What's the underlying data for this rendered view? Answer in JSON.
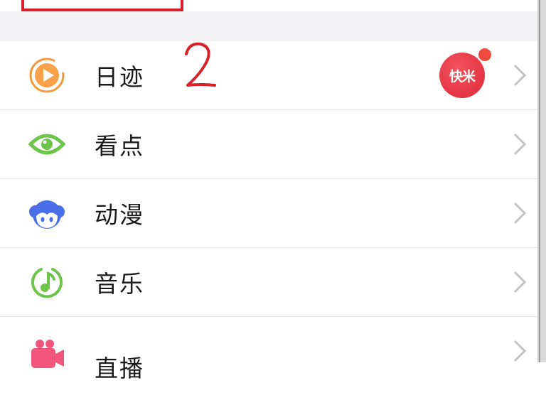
{
  "menu": {
    "items": [
      {
        "label": "日迹",
        "icon": "orange-play-circle-icon",
        "badge": "快米"
      },
      {
        "label": "看点",
        "icon": "green-eye-icon"
      },
      {
        "label": "动漫",
        "icon": "blue-anime-face-icon"
      },
      {
        "label": "音乐",
        "icon": "green-music-note-icon"
      },
      {
        "label": "直播",
        "icon": "pink-video-camera-icon"
      }
    ]
  },
  "annotation": {
    "number": "2",
    "color": "#d8202a"
  },
  "colors": {
    "orange": "#f59a3c",
    "green": "#6cc44a",
    "blue": "#4a6ee8",
    "pink": "#f2557a",
    "badge_red": "#e0283a"
  }
}
